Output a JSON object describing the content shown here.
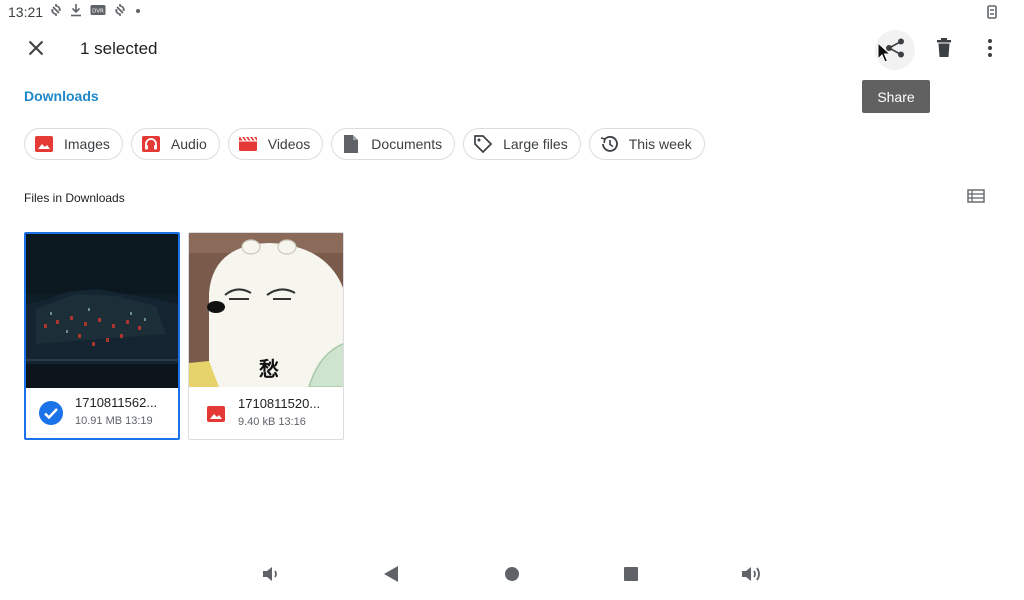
{
  "status_bar": {
    "time": "13:21",
    "icons": [
      "sync-icon",
      "download-icon",
      "dvr-icon",
      "sync-icon",
      "dot-icon"
    ],
    "right_icon": "screen-rotation-icon"
  },
  "app_bar": {
    "title": "1 selected",
    "close_icon": "close-icon",
    "actions": [
      "share-icon",
      "delete-icon",
      "more-vert-icon"
    ]
  },
  "tooltip": {
    "text": "Share"
  },
  "breadcrumb": {
    "label": "Downloads"
  },
  "chips": [
    {
      "label": "Images",
      "icon": "image-icon"
    },
    {
      "label": "Audio",
      "icon": "headphones-icon"
    },
    {
      "label": "Videos",
      "icon": "movie-icon"
    },
    {
      "label": "Documents",
      "icon": "document-icon"
    },
    {
      "label": "Large files",
      "icon": "tag-icon"
    },
    {
      "label": "This week",
      "icon": "history-icon"
    }
  ],
  "section": {
    "title": "Files in Downloads",
    "view_toggle_icon": "list-view-icon"
  },
  "files": [
    {
      "name": "1710811562...",
      "meta": "10.91 MB 13:19",
      "selected": true,
      "icon": "check-circle-icon",
      "thumb_text": ""
    },
    {
      "name": "1710811520...",
      "meta": "9.40 kB 13:16",
      "selected": false,
      "icon": "image-icon",
      "thumb_text": "愁"
    }
  ],
  "nav_bar": {
    "buttons": [
      "volume-down-icon",
      "back-icon",
      "home-icon",
      "recents-icon",
      "volume-up-icon"
    ]
  },
  "colors": {
    "accent": "#1a73e8",
    "breadcrumb": "#1e88c8",
    "chip_icon_red": "#e53935",
    "tooltip_bg": "#616161"
  }
}
